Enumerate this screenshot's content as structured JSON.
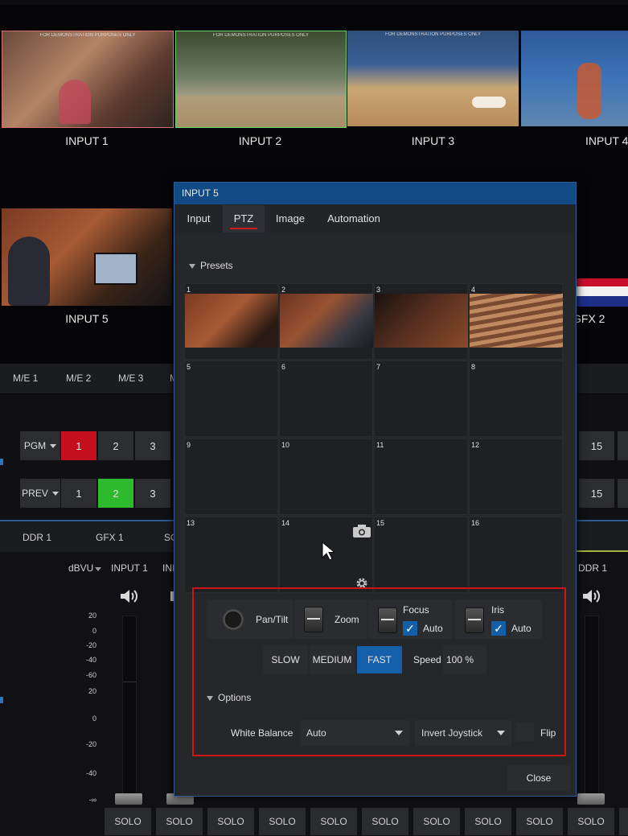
{
  "inputs_row": {
    "overlay_text": "FOR DEMONSTRATION PURPOSES ONLY",
    "inputs": [
      {
        "label": "INPUT 1"
      },
      {
        "label": "INPUT 2"
      },
      {
        "label": "INPUT 3"
      },
      {
        "label": "INPUT 4"
      }
    ],
    "input5": {
      "label": "INPUT 5"
    },
    "gfx2": {
      "label": "GFX 2"
    }
  },
  "me_tabs": [
    "M/E 1",
    "M/E 2",
    "M/E 3",
    "M"
  ],
  "switcher": {
    "pgm_label": "PGM",
    "prev_label": "PREV",
    "pgm_buttons": [
      "1",
      "2",
      "3"
    ],
    "prev_buttons": [
      "1",
      "2",
      "3"
    ],
    "right_button": "15",
    "pgm_active": "1",
    "prev_active": "2"
  },
  "audio": {
    "tabs": [
      "DDR 1",
      "GFX 1",
      "SO"
    ],
    "dbvu_label": "dBVU",
    "channel_label": "INPUT 1",
    "channel_partial": "INI",
    "right_channel_label": "DDR 1",
    "scale": [
      "20",
      "0",
      "-20",
      "-40",
      "-60",
      "20",
      "0",
      "-20",
      "-40",
      "-∞"
    ],
    "solo_label": "SOLO"
  },
  "dialog": {
    "title": "INPUT 5",
    "tabs": [
      {
        "label": "Input"
      },
      {
        "label": "PTZ"
      },
      {
        "label": "Image"
      },
      {
        "label": "Automation"
      }
    ],
    "presets_label": "Presets",
    "preset_numbers": [
      "1",
      "2",
      "3",
      "4",
      "5",
      "6",
      "7",
      "8",
      "9",
      "10",
      "11",
      "12",
      "13",
      "14",
      "15",
      "16"
    ],
    "controls": {
      "pan_tilt": "Pan/Tilt",
      "zoom": "Zoom",
      "focus": "Focus",
      "focus_auto": "Auto",
      "iris": "Iris",
      "iris_auto": "Auto",
      "speed_slow": "SLOW",
      "speed_medium": "MEDIUM",
      "speed_fast": "FAST",
      "speed_label": "Speed",
      "speed_value": "100 %"
    },
    "options_label": "Options",
    "white_balance_label": "White Balance",
    "white_balance_value": "Auto",
    "invert_joystick": "Invert Joystick",
    "flip_label": "Flip",
    "close_label": "Close"
  },
  "colors": {
    "title_bar": "#114a84",
    "active_tab_underline": "#d11a1a",
    "highlight_border": "#d01515",
    "pgm_active": "#c4101e",
    "prev_active": "#2dbb2d",
    "fast_active": "#1560a8"
  }
}
